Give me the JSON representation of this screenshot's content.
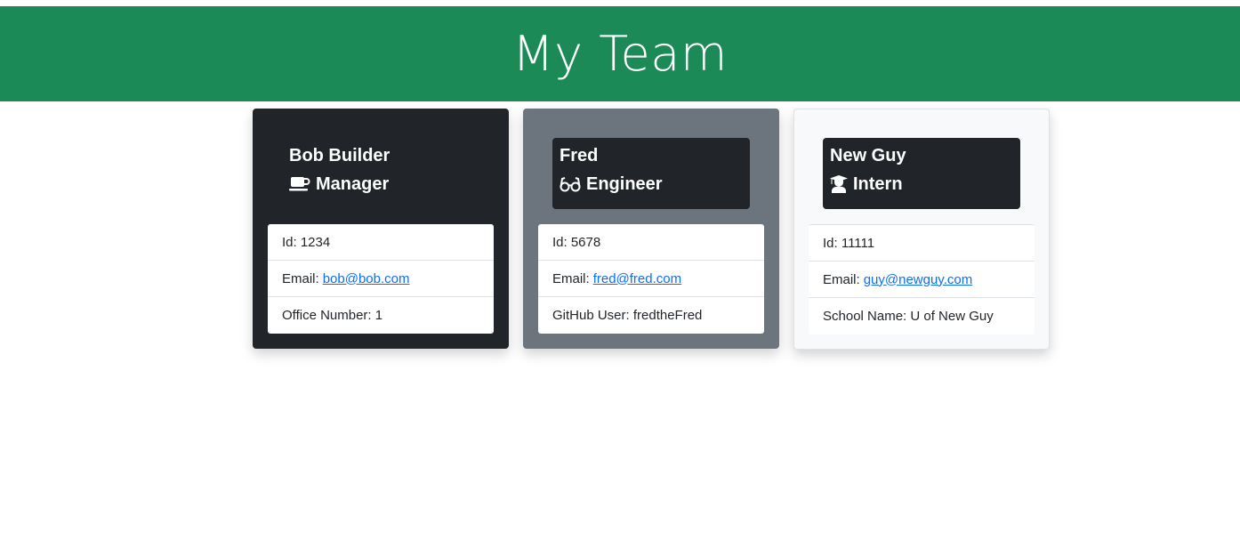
{
  "header": {
    "title": "My Team"
  },
  "colors": {
    "banner": "#1b8a57",
    "manager_card": "#212529",
    "engineer_card": "#6c757d",
    "intern_card": "#f8f9fa",
    "link": "#0d6efd"
  },
  "cards": [
    {
      "name": "Bob Builder",
      "role": "Manager",
      "icon": "coffee-mug-icon",
      "id_label": "Id: 1234",
      "email_prefix": "Email:",
      "email": "bob@bob.com",
      "extra": "Office Number: 1"
    },
    {
      "name": "Fred",
      "role": "Engineer",
      "icon": "glasses-icon",
      "id_label": "Id: 5678",
      "email_prefix": "Email:",
      "email": "fred@fred.com",
      "extra": "GitHub User: fredtheFred"
    },
    {
      "name": "New Guy",
      "role": "Intern",
      "icon": "graduate-icon",
      "id_label": "Id: 11111",
      "email_prefix": "Email:",
      "email": "guy@newguy.com",
      "extra": "School Name: U of New Guy"
    }
  ]
}
